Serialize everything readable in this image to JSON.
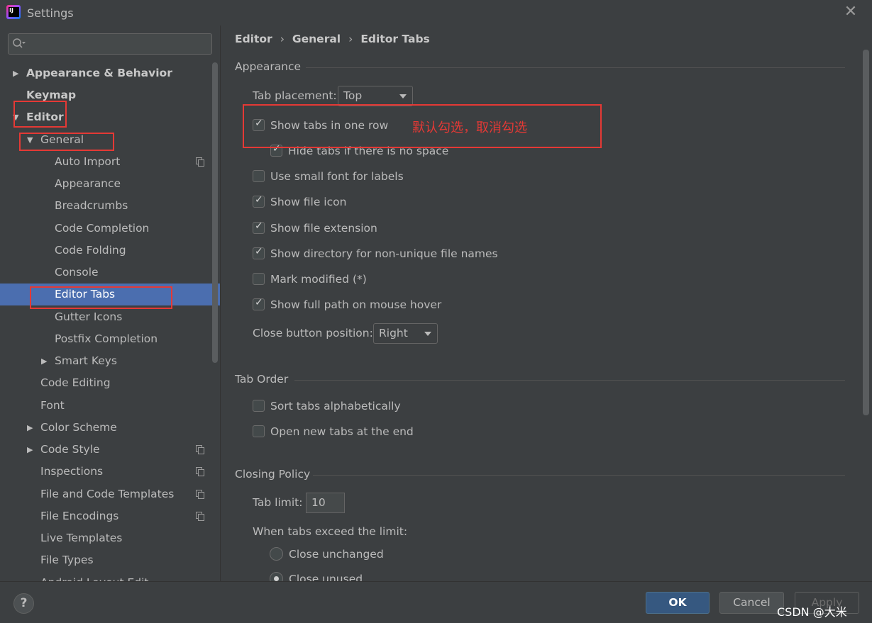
{
  "window": {
    "title": "Settings",
    "close_glyph": "✕"
  },
  "search": {
    "placeholder": "",
    "icon": "search-icon"
  },
  "sidebar": {
    "items": [
      {
        "label": "Appearance & Behavior",
        "level": 0,
        "bold": true,
        "expander": "▶"
      },
      {
        "label": "Keymap",
        "level": 0,
        "bold": true,
        "expander": ""
      },
      {
        "label": "Editor",
        "level": 0,
        "bold": true,
        "expander": "▼"
      },
      {
        "label": "General",
        "level": 1,
        "bold": false,
        "expander": "▼"
      },
      {
        "label": "Auto Import",
        "level": 2,
        "project": true
      },
      {
        "label": "Appearance",
        "level": 2
      },
      {
        "label": "Breadcrumbs",
        "level": 2
      },
      {
        "label": "Code Completion",
        "level": 2
      },
      {
        "label": "Code Folding",
        "level": 2
      },
      {
        "label": "Console",
        "level": 2
      },
      {
        "label": "Editor Tabs",
        "level": 2,
        "selected": true
      },
      {
        "label": "Gutter Icons",
        "level": 2
      },
      {
        "label": "Postfix Completion",
        "level": 2
      },
      {
        "label": "Smart Keys",
        "level": 2,
        "expander": "▶"
      },
      {
        "label": "Code Editing",
        "level": 1
      },
      {
        "label": "Font",
        "level": 1
      },
      {
        "label": "Color Scheme",
        "level": 1,
        "expander": "▶"
      },
      {
        "label": "Code Style",
        "level": 1,
        "expander": "▶",
        "project": true
      },
      {
        "label": "Inspections",
        "level": 1,
        "project": true
      },
      {
        "label": "File and Code Templates",
        "level": 1,
        "project": true
      },
      {
        "label": "File Encodings",
        "level": 1,
        "project": true
      },
      {
        "label": "Live Templates",
        "level": 1
      },
      {
        "label": "File Types",
        "level": 1
      },
      {
        "label": "Android Layout Edit",
        "level": 1
      }
    ]
  },
  "breadcrumb": {
    "a": "Editor",
    "b": "General",
    "c": "Editor Tabs",
    "sep": "›"
  },
  "appearance": {
    "heading": "Appearance",
    "tab_placement_label": "Tab placement:",
    "tab_placement_value": "Top",
    "options": [
      {
        "label": "Show tabs in one row",
        "checked": true
      },
      {
        "label": "Hide tabs if there is no space",
        "checked": true
      },
      {
        "label": "Use small font for labels",
        "checked": false
      },
      {
        "label": "Show file icon",
        "checked": true
      },
      {
        "label": "Show file extension",
        "checked": true
      },
      {
        "label": "Show directory for non-unique file names",
        "checked": true
      },
      {
        "label": "Mark modified (*)",
        "checked": false
      },
      {
        "label": "Show full path on mouse hover",
        "checked": true
      }
    ],
    "close_button_label": "Close button position:",
    "close_button_value": "Right"
  },
  "tab_order": {
    "heading": "Tab Order",
    "options": [
      {
        "label": "Sort tabs alphabetically",
        "checked": false
      },
      {
        "label": "Open new tabs at the end",
        "checked": false
      }
    ]
  },
  "closing_policy": {
    "heading": "Closing Policy",
    "tab_limit_label": "Tab limit:",
    "tab_limit_value": "10",
    "exceed_label": "When tabs exceed the limit:",
    "radios": [
      {
        "label": "Close unchanged",
        "selected": false
      },
      {
        "label": "Close unused",
        "selected": true
      }
    ]
  },
  "annotation": {
    "note": "默认勾选，取消勾选",
    "color": "#e53935"
  },
  "footer": {
    "help": "?",
    "ok": "OK",
    "cancel": "Cancel",
    "apply": "Apply",
    "watermark": "CSDN @大米"
  },
  "colors": {
    "background": "#3c3f41",
    "selection": "#4b6eaf",
    "ok_button": "#365880",
    "text": "#bbbbbb"
  }
}
